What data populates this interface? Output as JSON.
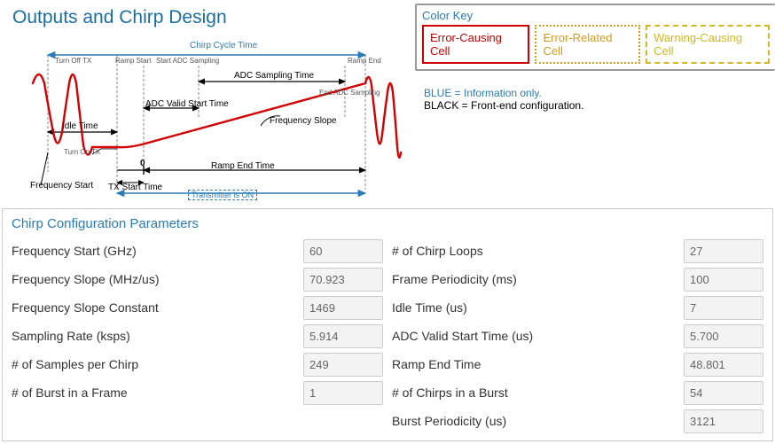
{
  "header": {
    "title": "Outputs and Chirp Design"
  },
  "diagram": {
    "labels": {
      "chirp_cycle_time": "Chirp Cycle Time",
      "turn_off_tx": "Turn Off TX",
      "ramp_start": "Ramp Start",
      "start_adc_sampling": "Start ADC Sampling",
      "ramp_end": "Ramp End",
      "adc_sampling_time": "ADC Sampling Time",
      "end_adc_sampling": "End ADC Sampling",
      "adc_valid_start_time": "ADC Valid Start Time",
      "frequency_slope": "Frequency Slope",
      "idle_time": "Idle Time",
      "turn_on_tx": "Turn On TX",
      "zero": "0",
      "ramp_end_time": "Ramp End Time",
      "frequency_start": "Frequency Start",
      "tx_start_time": "TX Start Time",
      "transmitter_is_on": "Transmitter is ON"
    }
  },
  "color_key": {
    "title": "Color Key",
    "error": "Error-Causing Cell",
    "related": "Error-Related Cell",
    "warning": "Warning-Causing Cell"
  },
  "legend": {
    "blue": "BLUE = Information only.",
    "black": "BLACK = Front-end configuration."
  },
  "params": {
    "title": "Chirp Configuration Parameters",
    "left": [
      {
        "label": "Frequency Start (GHz)",
        "value": "60"
      },
      {
        "label": "Frequency Slope (MHz/us)",
        "value": "70.923"
      },
      {
        "label": "Frequency Slope Constant",
        "value": "1469"
      },
      {
        "label": "Sampling Rate (ksps)",
        "value": "5.914"
      },
      {
        "label": "# of Samples per Chirp",
        "value": "249"
      },
      {
        "label": "# of Burst in a Frame",
        "value": "1"
      }
    ],
    "right": [
      {
        "label": "# of Chirp Loops",
        "value": "27"
      },
      {
        "label": "Frame Periodicity (ms)",
        "value": "100"
      },
      {
        "label": "Idle Time (us)",
        "value": "7"
      },
      {
        "label": "ADC Valid Start Time (us)",
        "value": "5.700"
      },
      {
        "label": "Ramp End Time",
        "value": "48.801"
      },
      {
        "label": "# of Chirps in a Burst",
        "value": "54"
      },
      {
        "label": "Burst Periodicity (us)",
        "value": "3121"
      }
    ]
  }
}
